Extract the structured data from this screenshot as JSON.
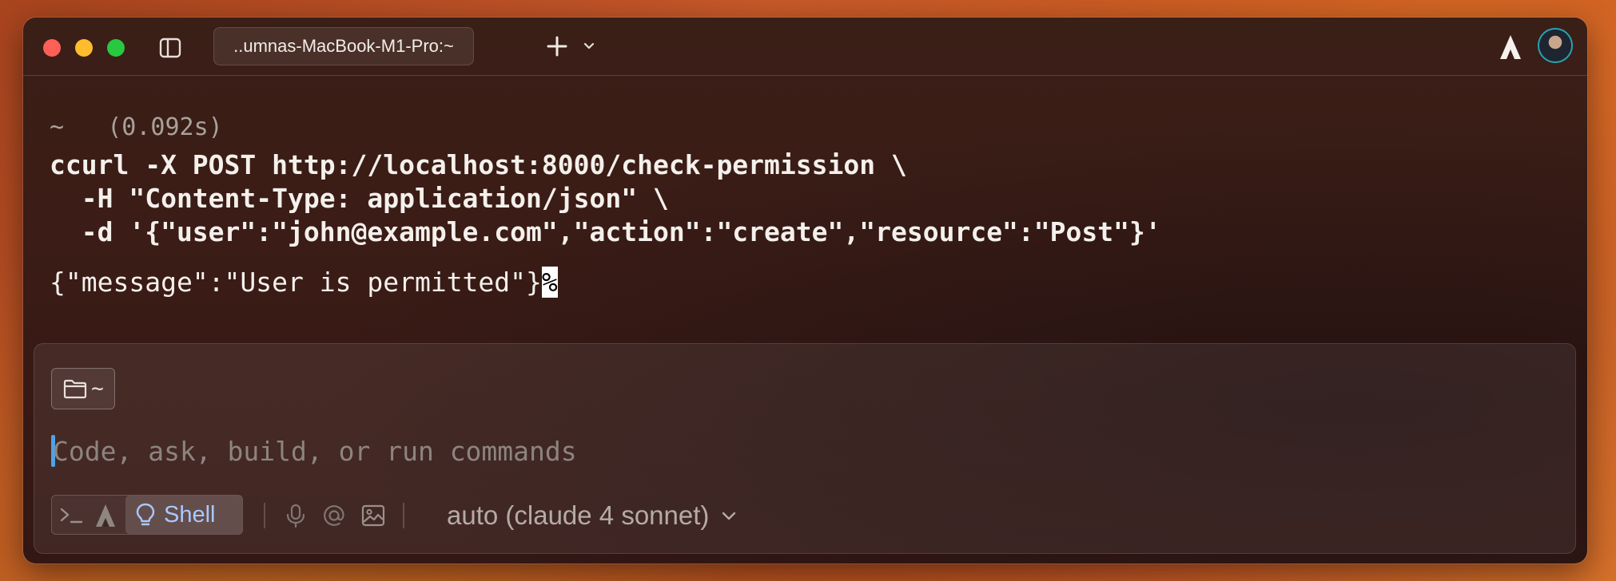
{
  "window": {
    "tab_title": "..umnas-MacBook-M1-Pro:~"
  },
  "block": {
    "directory": "~",
    "duration": "(0.092s)",
    "command_lines": [
      "ccurl -X POST http://localhost:8000/check-permission \\",
      "  -H \"Content-Type: application/json\" \\",
      "  -d '{\"user\":\"john@example.com\",\"action\":\"create\",\"resource\":\"Post\"}'"
    ],
    "output": "{\"message\":\"User is permitted\"}",
    "output_end_marker": "%"
  },
  "input": {
    "dir_chip": "~",
    "placeholder": "Code, ask, build, or run commands",
    "mode_label": "Shell",
    "model_label": "auto (claude 4 sonnet)"
  },
  "colors": {
    "close": "#fe5f57",
    "minimize": "#febc2e",
    "maximize": "#28c840",
    "caret": "#4fa3e6",
    "shell_mode": "#a9c8ff"
  },
  "icons": {
    "sidebar": "sidebar-toggle-icon",
    "new_tab": "plus-icon",
    "chevron": "chevron-down-icon",
    "agent": "agent-logo-icon",
    "folder": "folder-icon",
    "terminal": "terminal-icon",
    "lightbulb": "lightbulb-icon",
    "microphone": "microphone-icon",
    "mention": "at-icon",
    "image": "image-icon"
  }
}
